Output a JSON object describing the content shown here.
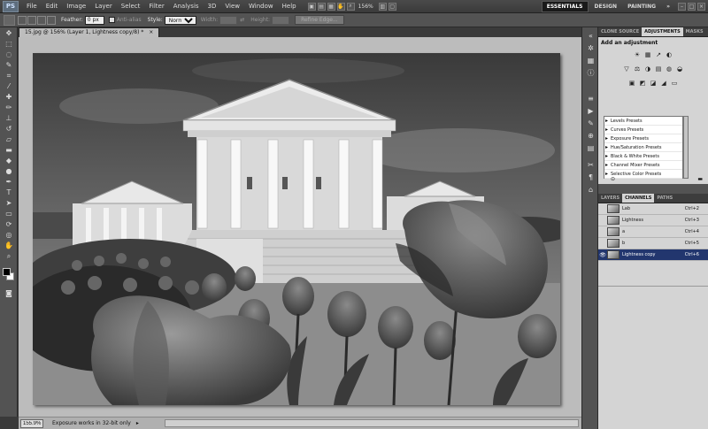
{
  "app": {
    "logo": "PS"
  },
  "menu": [
    "File",
    "Edit",
    "Image",
    "Layer",
    "Select",
    "Filter",
    "Analysis",
    "3D",
    "View",
    "Window",
    "Help"
  ],
  "topbar": {
    "zoom": "156%",
    "workspaces": [
      "ESSENTIALS",
      "DESIGN",
      "PAINTING",
      "»"
    ],
    "window_controls": [
      "–",
      "□",
      "×"
    ]
  },
  "options": {
    "feather_label": "Feather:",
    "feather_value": "0 px",
    "antialias_label": "Anti-alias",
    "style_label": "Style:",
    "style_value": "Normal",
    "width_label": "Width:",
    "height_label": "Height:",
    "refine_button": "Refine Edge..."
  },
  "document": {
    "tab_title": "15.jpg @ 156% (Layer 1, Lightness copy/8) *",
    "close": "×"
  },
  "status": {
    "zoom": "155.9%",
    "message": "Exposure works in 32-bit only",
    "arrow": "▸"
  },
  "adjustments_panel": {
    "tabs": [
      "CLONE SOURCE",
      "ADJUSTMENTS",
      "MASKS"
    ],
    "title": "Add an adjustment",
    "icon_rows": [
      [
        "☀",
        "▦",
        "↗",
        "◐"
      ],
      [
        "▽",
        "⚖",
        "◑",
        "▤",
        "◍",
        "◒"
      ],
      [
        "▣",
        "◩",
        "◪",
        "◢",
        "▭"
      ]
    ],
    "presets": [
      "Levels Presets",
      "Curves Presets",
      "Exposure Presets",
      "Hue/Saturation Presets",
      "Black & White Presets",
      "Channel Mixer Presets",
      "Selective Color Presets"
    ]
  },
  "channels_panel": {
    "tabs": [
      "LAYERS",
      "CHANNELS",
      "PATHS"
    ],
    "rows": [
      {
        "name": "Lab",
        "shortcut": "Ctrl+2",
        "visible": false,
        "selected": false
      },
      {
        "name": "Lightness",
        "shortcut": "Ctrl+3",
        "visible": false,
        "selected": false
      },
      {
        "name": "a",
        "shortcut": "Ctrl+4",
        "visible": false,
        "selected": false
      },
      {
        "name": "b",
        "shortcut": "Ctrl+5",
        "visible": false,
        "selected": false
      },
      {
        "name": "Lightness copy",
        "shortcut": "Ctrl+6",
        "visible": true,
        "selected": true
      }
    ]
  }
}
